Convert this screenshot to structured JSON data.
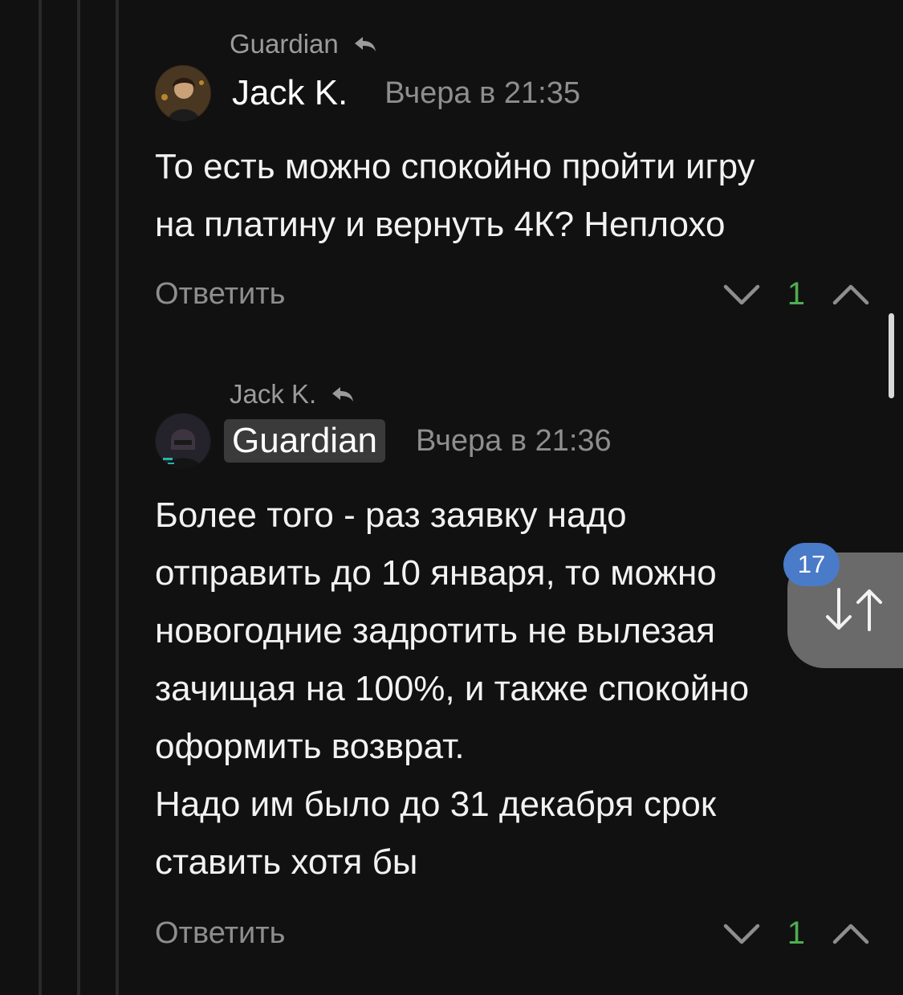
{
  "comments": [
    {
      "reply_to": "Guardian",
      "author": "Jack K.",
      "time": "Вчера в 21:35",
      "text_lines": [
        "То есть можно спокойно пройти игру",
        "на платину и вернуть 4К? Неплохо"
      ],
      "reply_label": "Ответить",
      "score": "1"
    },
    {
      "reply_to": "Jack K.",
      "author": "Guardian",
      "time": "Вчера в 21:36",
      "text_lines": [
        "Более того - раз заявку надо",
        "отправить до 10 января, то можно",
        "новогодние задротить не вылезая",
        "зачищая на 100%, и также спокойно",
        "оформить возврат.",
        "Надо им было до 31 декабря срок",
        "ставить хотя бы"
      ],
      "reply_label": "Ответить",
      "score": "1"
    }
  ],
  "nav": {
    "badge_count": "17",
    "icon": "sort-arrows-icon"
  },
  "colors": {
    "background": "#111111",
    "score": "#4caf50",
    "badge": "#4a7bc8",
    "muted": "#8e8e8e"
  }
}
